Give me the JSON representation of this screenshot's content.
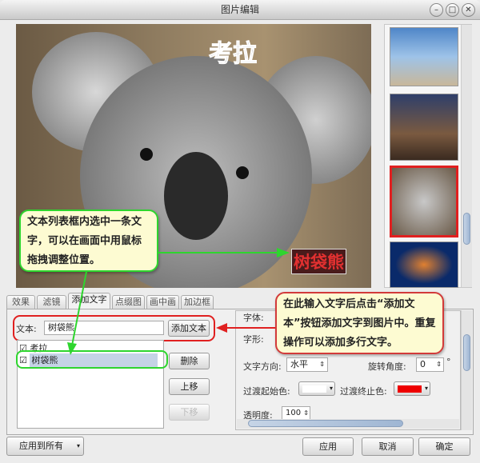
{
  "window": {
    "title": "图片编辑",
    "controls": [
      "minimize",
      "maximize",
      "close"
    ]
  },
  "photo": {
    "overlay_texts": [
      "考拉",
      "树袋熊"
    ]
  },
  "thumbnails": [
    {
      "name": "penguins"
    },
    {
      "name": "lighthouse"
    },
    {
      "name": "koala",
      "selected": true
    },
    {
      "name": "jellyfish"
    }
  ],
  "tabs": [
    {
      "label": "效果"
    },
    {
      "label": "滤镜"
    },
    {
      "label": "添加文字",
      "active": true
    },
    {
      "label": "点缀图"
    },
    {
      "label": "画中画"
    },
    {
      "label": "加边框"
    }
  ],
  "text_panel": {
    "text_label": "文本:",
    "text_value": "树袋熊",
    "add_button": "添加文本",
    "list_items": [
      {
        "label": "考拉",
        "checked": true
      },
      {
        "label": "树袋熊",
        "checked": true,
        "selected": true
      }
    ],
    "delete_button": "删除",
    "move_up_button": "上移",
    "move_down_button": "下移"
  },
  "props": {
    "font_label": "字体:",
    "style_label": "字形:",
    "direction_label": "文字方向:",
    "direction_value": "水平",
    "rotation_label": "旋转角度:",
    "rotation_value": "0",
    "rotation_unit": "°",
    "start_color_label": "过渡起始色:",
    "start_color": "#ffffff",
    "end_color_label": "过渡终止色:",
    "end_color": "#ee0000",
    "opacity_label": "透明度:",
    "opacity_value": "100"
  },
  "callouts": {
    "yellow": "在此输入文字后点击“添加文本”按钮添加文字到图片中。重复操作可以添加多行文字。",
    "green": "文本列表框内选中一条文字，可以在画面中用鼠标拖拽调整位置。"
  },
  "footer": {
    "apply_all": "应用到所有",
    "apply": "应用",
    "cancel": "取消",
    "ok": "确定"
  }
}
